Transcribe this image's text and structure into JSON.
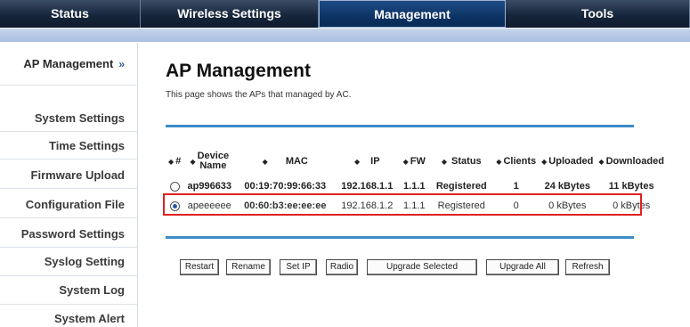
{
  "topnav": {
    "tabs": [
      {
        "label": "Status"
      },
      {
        "label": "Wireless Settings"
      },
      {
        "label": "Management"
      },
      {
        "label": "Tools"
      }
    ],
    "active": "Management"
  },
  "sidebar": {
    "items": [
      {
        "label": "AP Management"
      },
      {
        "label": "System Settings"
      },
      {
        "label": "Time Settings"
      },
      {
        "label": "Firmware Upload"
      },
      {
        "label": "Configuration File"
      },
      {
        "label": "Password Settings"
      },
      {
        "label": "Syslog Setting"
      },
      {
        "label": "System Log"
      },
      {
        "label": "System Alert"
      }
    ],
    "chevron": "»"
  },
  "main": {
    "title": "AP Management",
    "description": "This page shows the APs that managed by AC."
  },
  "table": {
    "headers": {
      "num": "#",
      "device_name_1": "Device",
      "device_name_2": "Name",
      "mac": "MAC",
      "ip": "IP",
      "fw": "FW",
      "status": "Status",
      "clients": "Clients",
      "uploaded": "Uploaded",
      "downloaded": "Downloaded"
    },
    "rows": [
      {
        "selected": false,
        "device_name": "ap996633",
        "mac": "00:19:70:99:66:33",
        "ip": "192.168.1.1",
        "fw": "1.1.1",
        "status": "Registered",
        "clients": "1",
        "uploaded": "24 kBytes",
        "downloaded": "11 kBytes"
      },
      {
        "selected": true,
        "device_name": "apeeeeee",
        "mac": "00:60:b3:ee:ee:ee",
        "ip": "192.168.1.2",
        "fw": "1.1.1",
        "status": "Registered",
        "clients": "0",
        "uploaded": "0 kBytes",
        "downloaded": "0 kBytes"
      }
    ]
  },
  "buttons": {
    "restart": "Restart",
    "rename": "Rename",
    "set_ip": "Set IP",
    "radio": "Radio",
    "upgrade_selected": "Upgrade Selected",
    "upgrade_all": "Upgrade All",
    "refresh": "Refresh"
  },
  "colors": {
    "nav_dark": "#17263c",
    "nav_active": "#0d3465",
    "subbar": "#b5c8e4",
    "rule": "#3b8cc7",
    "highlight": "#e02020"
  },
  "icons": {
    "sort": "sort-arrows-icon",
    "sidebar_chevron": "double-chevron-right-icon",
    "row_select": "radio-button-icon"
  }
}
